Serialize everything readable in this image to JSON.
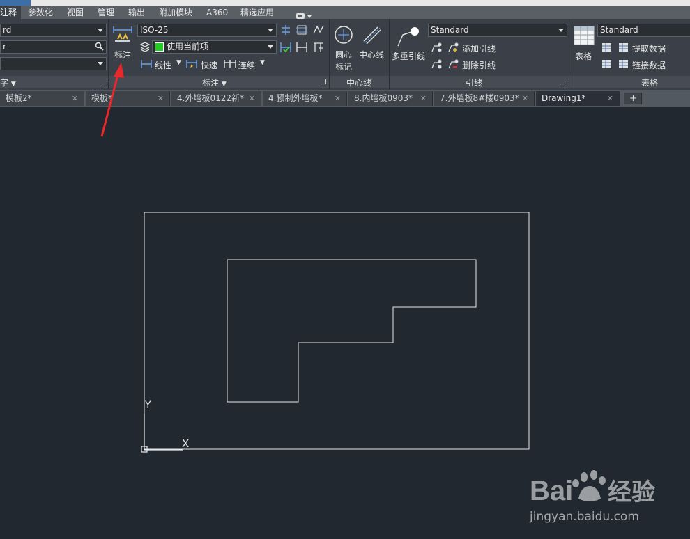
{
  "ribbon_tabs": [
    "注释",
    "参数化",
    "视图",
    "管理",
    "输出",
    "附加模块",
    "A360",
    "精选应用"
  ],
  "text_panel": {
    "combo1": "rd",
    "combo2": "r",
    "combo3": "",
    "title": "字"
  },
  "dim_panel": {
    "big_button": "标注",
    "style_combo": "ISO-25",
    "layer_combo": "使用当前项",
    "linear": "线性",
    "quick": "快速",
    "continue": "连续",
    "title": "标注"
  },
  "center_panel": {
    "center_mark_line1": "圆心",
    "center_mark_line2": "标记",
    "centerline": "中心线",
    "title": "中心线"
  },
  "leader_panel": {
    "multileader": "多重引线",
    "style_combo": "Standard",
    "add": "添加引线",
    "remove": "删除引线",
    "title": "引线"
  },
  "table_panel": {
    "table": "表格",
    "style_combo": "Standard",
    "extract": "提取数据",
    "link": "链接数据",
    "title": "表格"
  },
  "doc_tabs": [
    "模板2*",
    "模板*",
    "4.外墙板0122新*",
    "4.预制外墙板*",
    "8.内墙板0903*",
    "7.外墙板8#楼0903*",
    "Drawing1*"
  ],
  "doc_tab_close": "✕",
  "new_tab": "+",
  "ucs": {
    "y": "Y",
    "x": "X"
  },
  "watermark": {
    "brand": "Bai du 经验",
    "url": "jingyan.baidu.com"
  },
  "colors": {
    "canvas": "#212830",
    "ribbon": "#3b4048",
    "arrow": "#e8282a",
    "layer_swatch": "#22cc22"
  }
}
